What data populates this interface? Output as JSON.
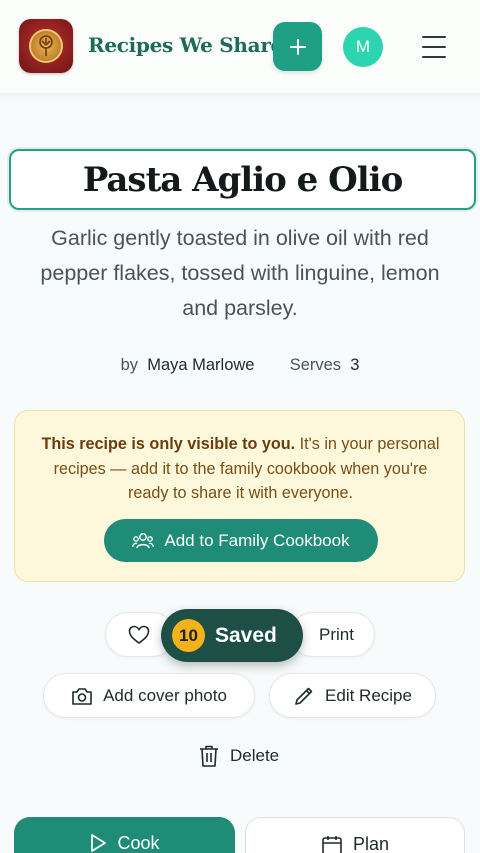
{
  "header": {
    "brand": "Recipes We Share",
    "add_label": "+",
    "avatar_initial": "M"
  },
  "recipe": {
    "title": "Pasta Aglio e Olio",
    "description": "Garlic gently toasted in olive oil with red pepper flakes, tossed with linguine, lemon and parsley.",
    "by_label": "by",
    "author": "Maya Marlowe",
    "serves_label": "Serves",
    "serves": "3"
  },
  "notice": {
    "bold": "This recipe is only visible to you.",
    "text": " It's in your personal recipes — add it to the family cookbook when you're ready to share it with everyone.",
    "button": "Add to Family Cookbook"
  },
  "actions": {
    "saved_count": "10",
    "saved_label": "Saved",
    "print": "Print",
    "add_cover": "Add cover photo",
    "edit": "Edit Recipe",
    "delete": "Delete",
    "cook": "Cook",
    "plan": "Plan"
  },
  "colors": {
    "accent": "#1e8c76",
    "notice_bg": "#fdf8dc",
    "toast_bg": "#1d4f47",
    "badge": "#f1b21c"
  }
}
